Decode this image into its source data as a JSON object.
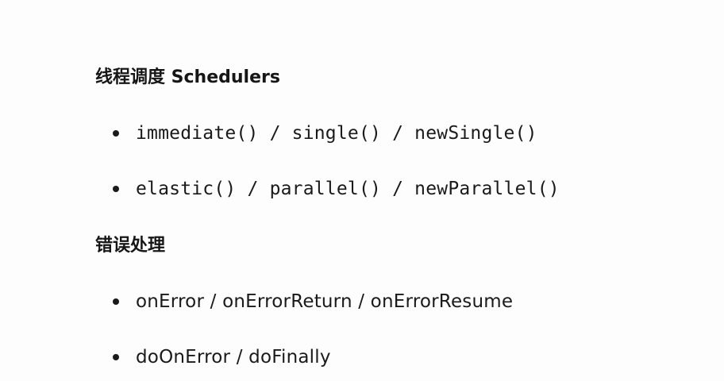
{
  "slide": {
    "section_scheduling": {
      "heading": "线程调度 Schedulers",
      "items": [
        "immediate() / single() / newSingle()",
        "elastic() / parallel() / newParallel()"
      ]
    },
    "section_error_handling": {
      "heading": "错误处理",
      "items": [
        "onError / onErrorReturn / onErrorResume",
        "doOnError / doFinally"
      ]
    }
  }
}
